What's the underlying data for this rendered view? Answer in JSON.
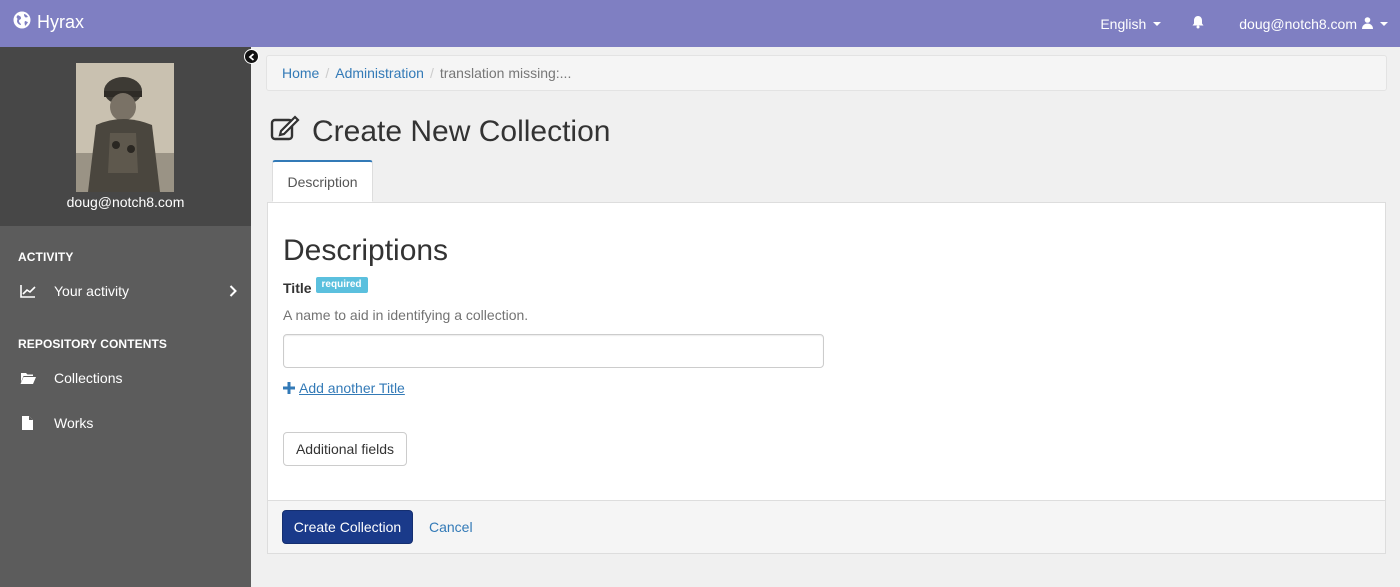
{
  "app": {
    "brand": "Hyrax"
  },
  "navbar": {
    "language": "English",
    "user": "doug@notch8.com"
  },
  "sidebar": {
    "profile_name": "doug@notch8.com",
    "sections": [
      {
        "heading": "ACTIVITY",
        "items": [
          {
            "label": "Your activity",
            "icon": "line-chart-icon"
          }
        ]
      },
      {
        "heading": "REPOSITORY CONTENTS",
        "items": [
          {
            "label": "Collections",
            "icon": "folder-open-icon"
          },
          {
            "label": "Works",
            "icon": "file-icon"
          }
        ]
      }
    ]
  },
  "breadcrumb": [
    {
      "label": "Home",
      "link": true
    },
    {
      "label": "Administration",
      "link": true
    },
    {
      "label": "translation missing:...",
      "link": false
    }
  ],
  "page": {
    "title": "Create New Collection",
    "tab": "Description"
  },
  "form": {
    "section_title": "Descriptions",
    "field_label": "Title",
    "required_badge": "required",
    "help_text": "A name to aid in identifying a collection.",
    "title_value": "",
    "add_another": "Add another Title",
    "additional_fields": "Additional fields",
    "submit": "Create Collection",
    "cancel": "Cancel"
  },
  "colors": {
    "navbar": "#7f7fc2",
    "sidebar": "#5c5c5c",
    "primary_button": "#1a3a8a",
    "link": "#337ab7",
    "badge": "#5bc0de"
  }
}
